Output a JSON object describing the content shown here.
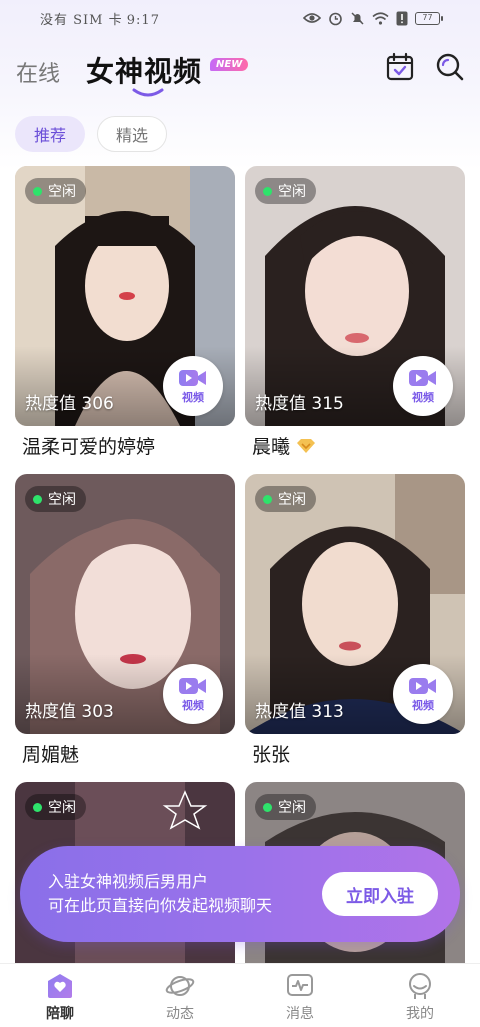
{
  "status_bar": {
    "carrier": "没有 SIM 卡",
    "time": "9:17",
    "battery": "77"
  },
  "header": {
    "tab_online": "在线",
    "tab_video": "女神视频",
    "new_badge": "NEW"
  },
  "filters": {
    "recommend": "推荐",
    "featured": "精选"
  },
  "cards": [
    {
      "status": "空闲",
      "heat": "热度值 306",
      "video_label": "视频",
      "name": "温柔可爱的婷婷"
    },
    {
      "status": "空闲",
      "heat": "热度值 315",
      "video_label": "视频",
      "name": "晨曦"
    },
    {
      "status": "空闲",
      "heat": "热度值 303",
      "video_label": "视频",
      "name": "周媚魅"
    },
    {
      "status": "空闲",
      "heat": "热度值 313",
      "video_label": "视频",
      "name": "张张"
    },
    {
      "status": "空闲"
    },
    {
      "status": "空闲"
    }
  ],
  "banner": {
    "line1": "入驻女神视频后男用户",
    "line2": "可在此页直接向你发起视频聊天",
    "button": "立即入驻"
  },
  "nav": {
    "chat": "陪聊",
    "moments": "动态",
    "messages": "消息",
    "mine": "我的"
  },
  "colors": {
    "accent": "#7c5ae6",
    "online_dot": "#2ee36b"
  }
}
